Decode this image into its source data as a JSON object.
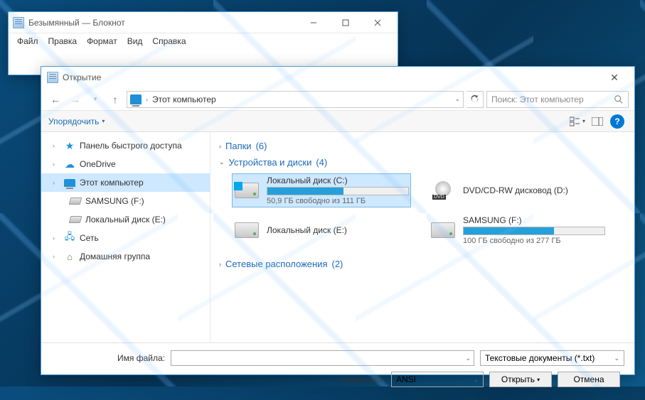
{
  "notepad": {
    "title": "Безымянный — Блокнот",
    "menu": [
      "Файл",
      "Правка",
      "Формат",
      "Вид",
      "Справка"
    ]
  },
  "dialog": {
    "title": "Открытие",
    "location": "Этот компьютер",
    "search_placeholder": "Поиск: Этот компьютер",
    "organize": "Упорядочить",
    "tree": [
      {
        "label": "Панель быстрого доступа",
        "icon": "star"
      },
      {
        "label": "OneDrive",
        "icon": "cloud"
      },
      {
        "label": "Этот компьютер",
        "icon": "pc",
        "selected": true
      },
      {
        "label": "SAMSUNG (F:)",
        "icon": "hdd",
        "sub": true
      },
      {
        "label": "Локальный диск (E:)",
        "icon": "hdd",
        "sub": true
      },
      {
        "label": "Сеть",
        "icon": "net"
      },
      {
        "label": "Домашняя группа",
        "icon": "home"
      }
    ],
    "groups": {
      "folders": {
        "label": "Папки",
        "count": "(6)",
        "expanded": false
      },
      "drives": {
        "label": "Устройства и диски",
        "count": "(4)",
        "expanded": true
      },
      "network": {
        "label": "Сетевые расположения",
        "count": "(2)",
        "expanded": false
      }
    },
    "drives": [
      {
        "name": "Локальный диск (C:)",
        "free": "50,9 ГБ свободно из 111 ГБ",
        "pct": 54,
        "icon": "win",
        "selected": true
      },
      {
        "name": "DVD/CD-RW дисковод (D:)",
        "icon": "dvd"
      },
      {
        "name": "Локальный диск (E:)",
        "icon": "drive"
      },
      {
        "name": "SAMSUNG (F:)",
        "free": "100 ГБ свободно из 277 ГБ",
        "pct": 64,
        "icon": "drive"
      }
    ],
    "filename_label": "Имя файла:",
    "encoding_label": "Кодировка:",
    "encoding_value": "ANSI",
    "filetype": "Текстовые документы (*.txt)",
    "open": "Открыть",
    "cancel": "Отмена"
  }
}
